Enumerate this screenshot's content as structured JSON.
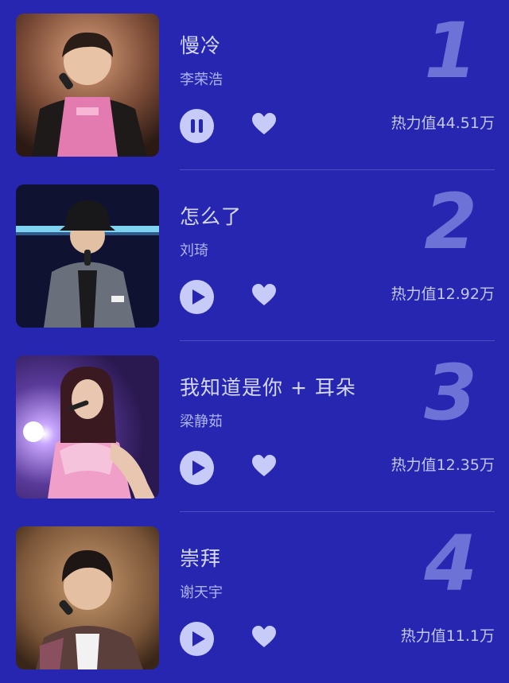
{
  "songs": [
    {
      "rank": "1",
      "title": "慢冷",
      "artist": "李荣浩",
      "heat": "热力值44.51万",
      "state": "pause"
    },
    {
      "rank": "2",
      "title": "怎么了",
      "artist": "刘琦",
      "heat": "热力值12.92万",
      "state": "play"
    },
    {
      "rank": "3",
      "title": "我知道是你 + 耳朵",
      "artist": "梁静茹",
      "heat": "热力值12.35万",
      "state": "play"
    },
    {
      "rank": "4",
      "title": "崇拜",
      "artist": "谢天宇",
      "heat": "热力值11.1万",
      "state": "play"
    }
  ],
  "colors": {
    "background": "#2626b0",
    "button": "#c6cbf8",
    "rank": "#6c72d6"
  }
}
